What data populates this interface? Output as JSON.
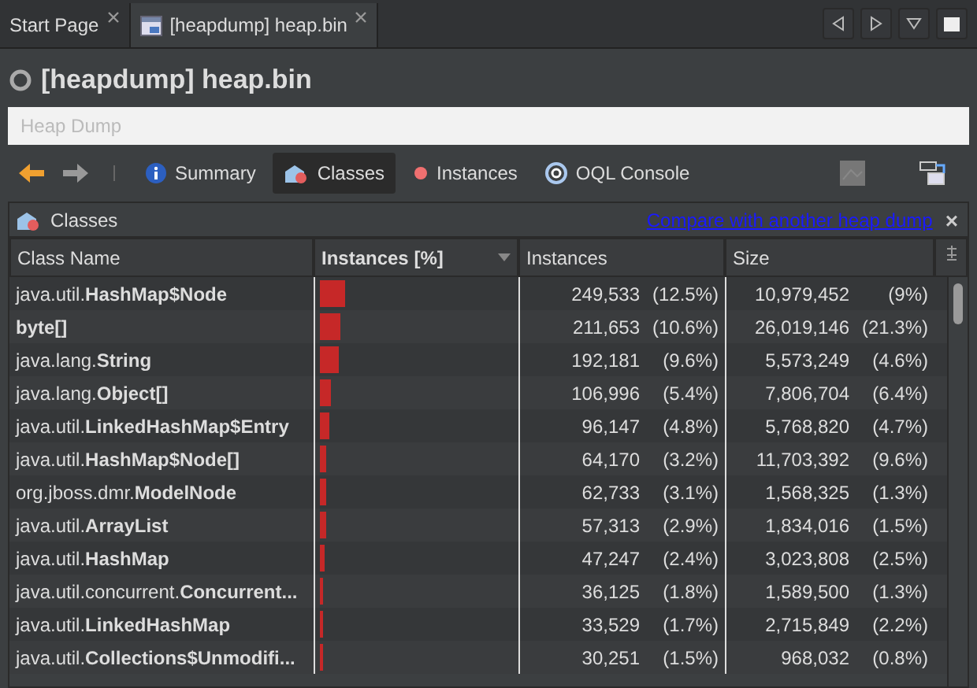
{
  "tabs": [
    {
      "label": "Start Page",
      "selected": false,
      "icon": false
    },
    {
      "label": "[heapdump] heap.bin",
      "selected": true,
      "icon": true
    }
  ],
  "title": "[heapdump] heap.bin",
  "breadcrumb": {
    "placeholder": "Heap Dump"
  },
  "views": [
    {
      "label": "Summary",
      "kind": "summary",
      "selected": false
    },
    {
      "label": "Classes",
      "kind": "classes",
      "selected": true
    },
    {
      "label": "Instances",
      "kind": "instances",
      "selected": false
    },
    {
      "label": "OQL Console",
      "kind": "oql",
      "selected": false
    }
  ],
  "panel": {
    "title": "Classes",
    "link": "Compare with another heap dump",
    "close": "×"
  },
  "columns": [
    {
      "label": "Class Name",
      "sorted": false
    },
    {
      "label": "Instances [%]",
      "sorted": true
    },
    {
      "label": "Instances",
      "sorted": false
    },
    {
      "label": "Size",
      "sorted": false
    }
  ],
  "rows": [
    {
      "name": "java.util.**HashMap$Node**",
      "level": 0.125,
      "instances": "249,533",
      "instances_pct": "(12.5%)",
      "size": "10,979,452",
      "size_pct": "(9%)"
    },
    {
      "name": "**byte[]**",
      "level": 0.106,
      "instances": "211,653",
      "instances_pct": "(10.6%)",
      "size": "26,019,146",
      "size_pct": "(21.3%)"
    },
    {
      "name": "java.lang.**String**",
      "level": 0.096,
      "instances": "192,181",
      "instances_pct": "(9.6%)",
      "size": "5,573,249",
      "size_pct": "(4.6%)"
    },
    {
      "name": "java.lang.**Object[]**",
      "level": 0.054,
      "instances": "106,996",
      "instances_pct": "(5.4%)",
      "size": "7,806,704",
      "size_pct": "(6.4%)"
    },
    {
      "name": "java.util.**LinkedHashMap$Entry**",
      "level": 0.048,
      "instances": "96,147",
      "instances_pct": "(4.8%)",
      "size": "5,768,820",
      "size_pct": "(4.7%)"
    },
    {
      "name": "java.util.**HashMap$Node[]**",
      "level": 0.032,
      "instances": "64,170",
      "instances_pct": "(3.2%)",
      "size": "11,703,392",
      "size_pct": "(9.6%)"
    },
    {
      "name": "org.jboss.dmr.**ModelNode**",
      "level": 0.031,
      "instances": "62,733",
      "instances_pct": "(3.1%)",
      "size": "1,568,325",
      "size_pct": "(1.3%)"
    },
    {
      "name": "java.util.**ArrayList**",
      "level": 0.029,
      "instances": "57,313",
      "instances_pct": "(2.9%)",
      "size": "1,834,016",
      "size_pct": "(1.5%)"
    },
    {
      "name": "java.util.**HashMap**",
      "level": 0.024,
      "instances": "47,247",
      "instances_pct": "(2.4%)",
      "size": "3,023,808",
      "size_pct": "(2.5%)"
    },
    {
      "name": "java.util.concurrent.**Concurrent...**",
      "level": 0.018,
      "instances": "36,125",
      "instances_pct": "(1.8%)",
      "size": "1,589,500",
      "size_pct": "(1.3%)"
    },
    {
      "name": "java.util.**LinkedHashMap**",
      "level": 0.017,
      "instances": "33,529",
      "instances_pct": "(1.7%)",
      "size": "2,715,849",
      "size_pct": "(2.2%)"
    },
    {
      "name": "java.util.**Collections$Unmodifi...**",
      "level": 0.015,
      "instances": "30,251",
      "instances_pct": "(1.5%)",
      "size": "968,032",
      "size_pct": "(0.8%)"
    }
  ]
}
